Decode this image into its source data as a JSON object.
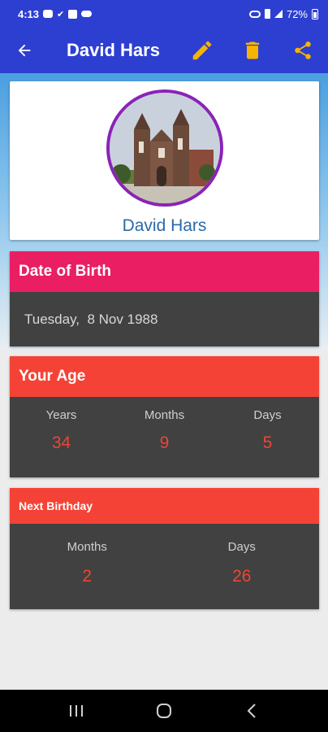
{
  "status_bar": {
    "time": "4:13",
    "battery": "72%",
    "icons": [
      "youtube-icon",
      "missed-call-icon",
      "image-icon",
      "cloud-icon",
      "gamepad-icon",
      "phone-vibrate-icon",
      "signal-icon",
      "battery-icon"
    ]
  },
  "app_bar": {
    "title": "David Hars",
    "icons": [
      "back-arrow-icon",
      "pencil-icon",
      "trash-icon",
      "share-icon"
    ],
    "accent_colors": {
      "bar": "#2d3fd0",
      "action_icons": "#f5b400"
    }
  },
  "profile": {
    "name": "David Hars",
    "avatar_ring_color": "#8a23b8"
  },
  "date_of_birth": {
    "heading": "Date of Birth",
    "value": "Tuesday,  8 Nov 1988",
    "heading_color": "#e91e63"
  },
  "age": {
    "heading": "Your Age",
    "heading_color": "#f44336",
    "columns": [
      {
        "label": "Years",
        "value": "34"
      },
      {
        "label": "Months",
        "value": "9"
      },
      {
        "label": "Days",
        "value": "5"
      }
    ]
  },
  "next_birthday": {
    "heading": "Next Birthday",
    "heading_color": "#f44336",
    "columns": [
      {
        "label": "Months",
        "value": "2"
      },
      {
        "label": "Days",
        "value": "26"
      }
    ]
  },
  "nav_bar": {
    "icons": [
      "recent-apps-icon",
      "home-icon",
      "back-icon"
    ]
  }
}
